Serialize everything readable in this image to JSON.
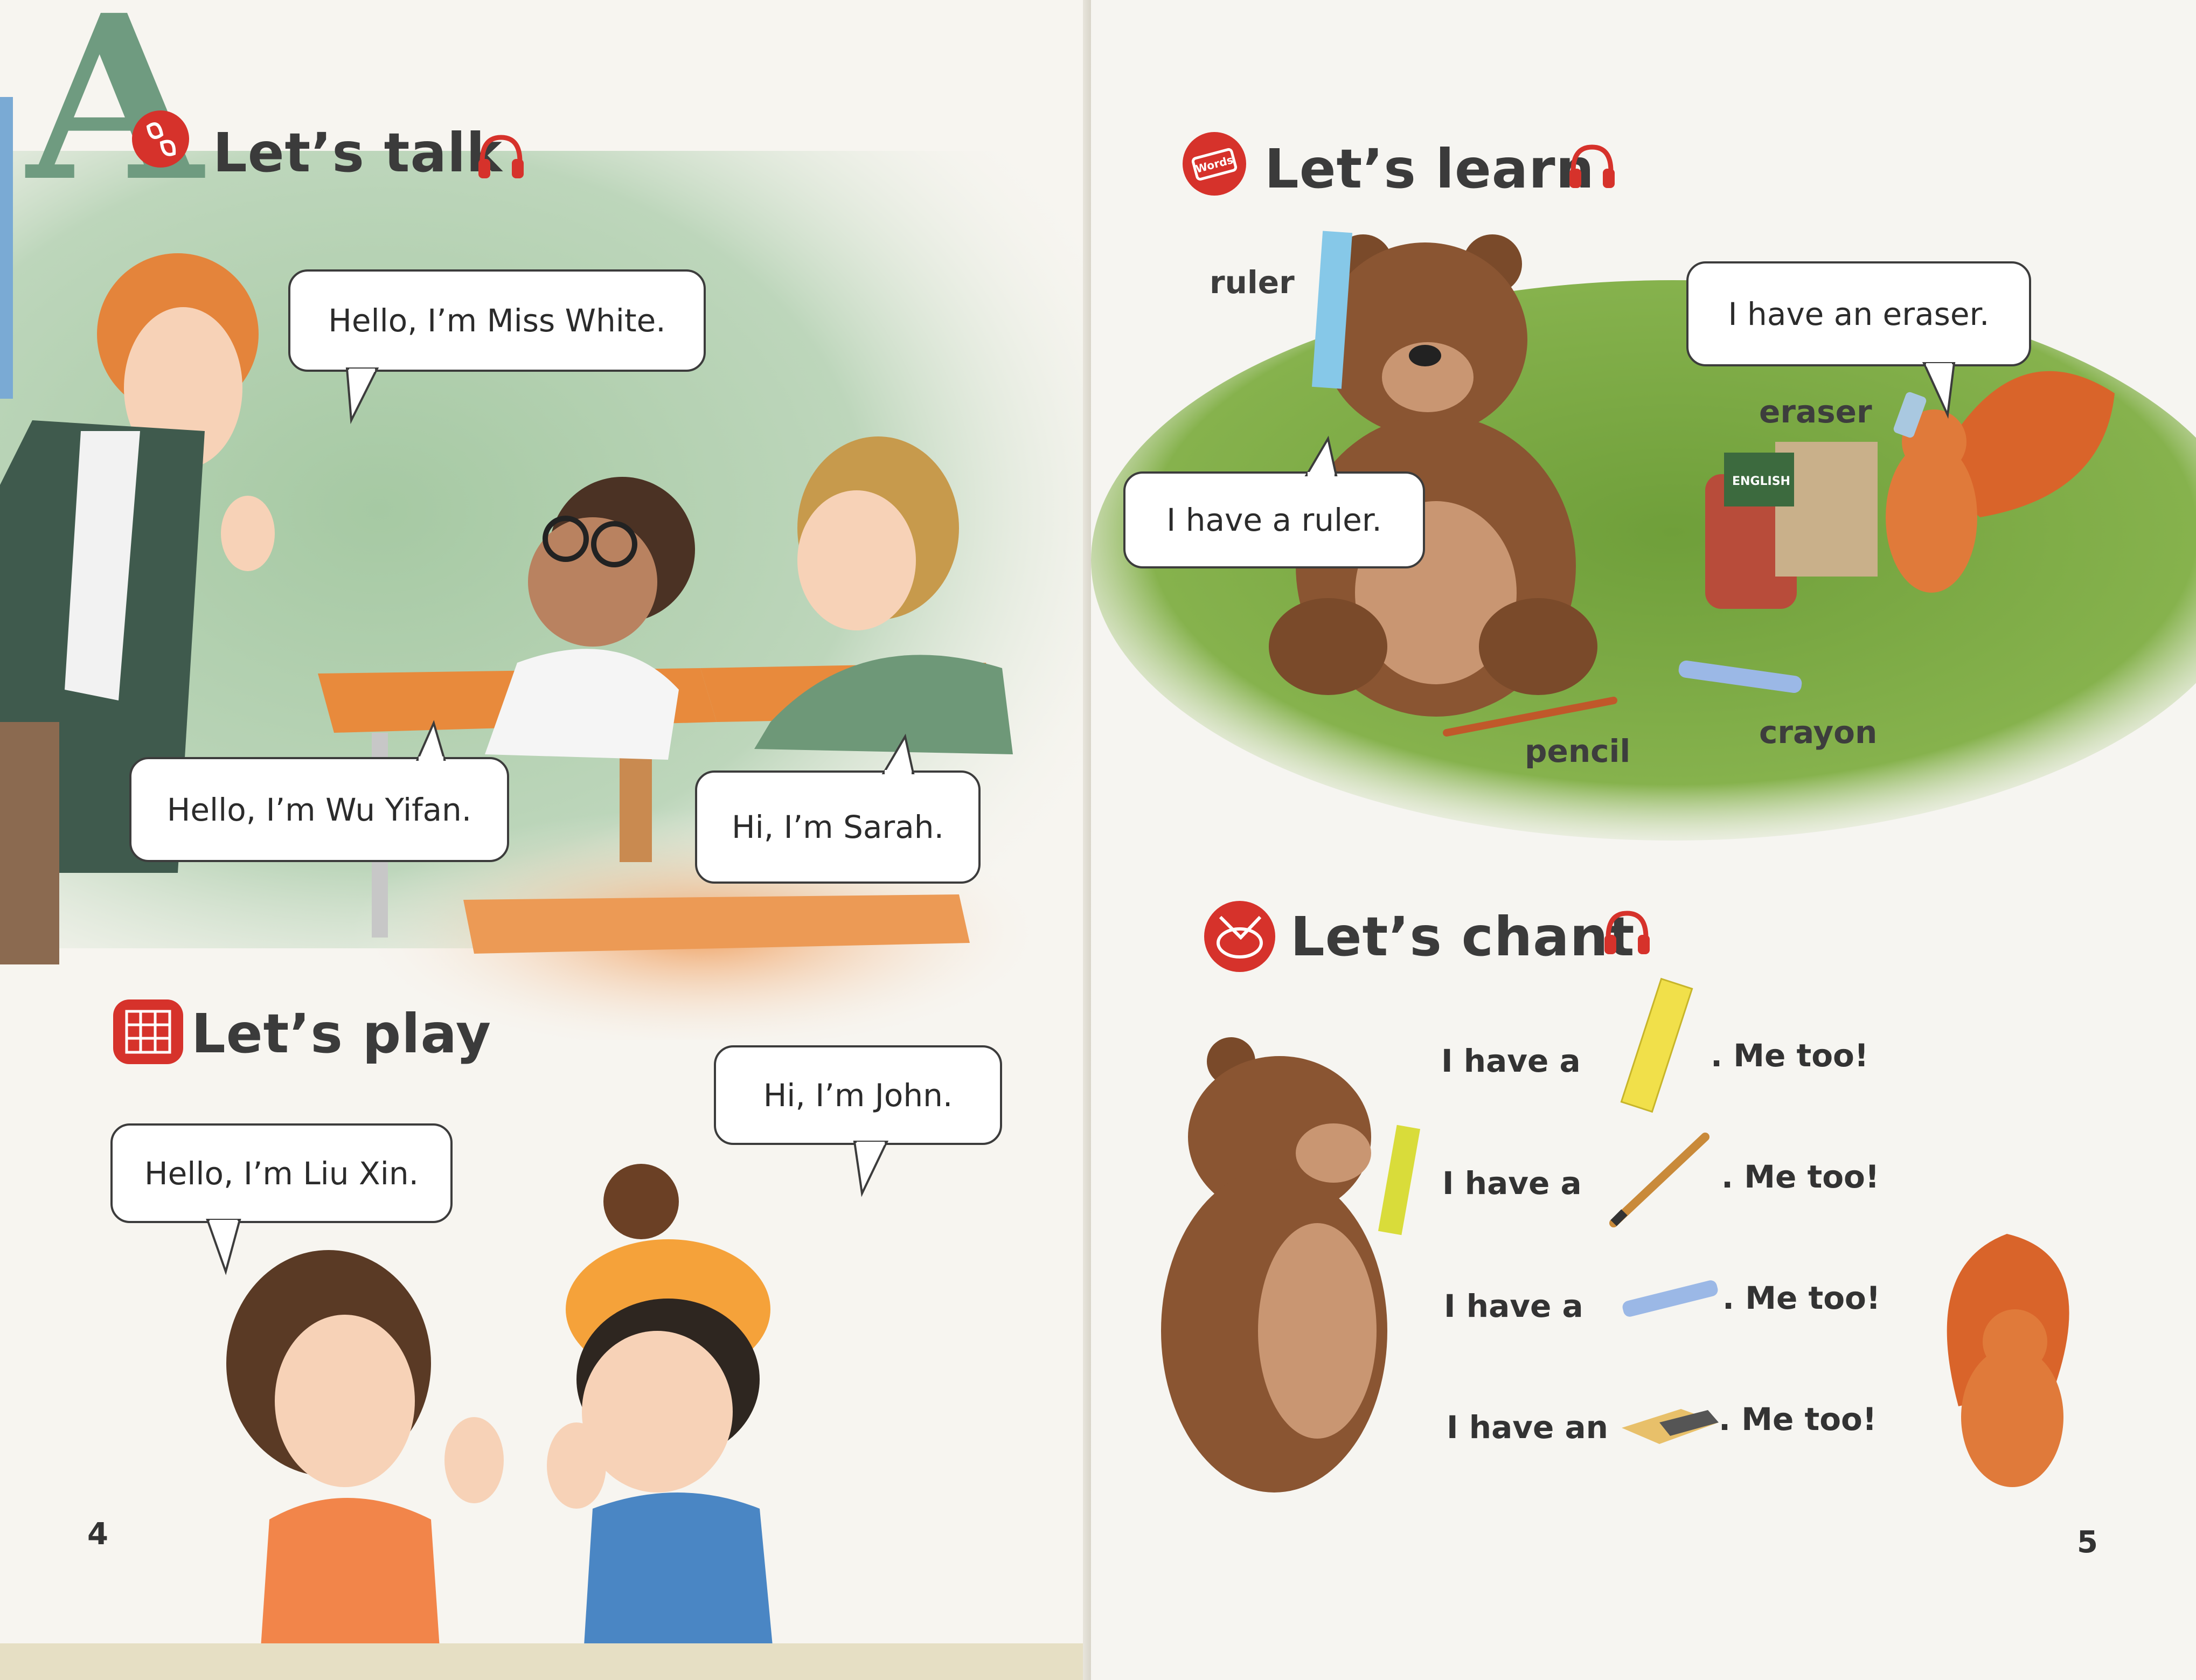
{
  "left_page": {
    "unit_letter": "A",
    "talk": {
      "title": "Let’s talk",
      "bubbles": {
        "teacher": "Hello, I’m Miss White.",
        "boy": "Hello, I’m Wu Yifan.",
        "girl": "Hi, I’m Sarah."
      }
    },
    "play": {
      "title": "Let’s play",
      "bubbles": {
        "girl": "Hello, I’m Liu Xin.",
        "boy": "Hi, I’m John."
      }
    },
    "page_number": "4"
  },
  "right_page": {
    "learn": {
      "title": "Let’s learn",
      "badge": "Words",
      "words": {
        "ruler": "ruler",
        "eraser": "eraser",
        "pencil": "pencil",
        "crayon": "crayon"
      },
      "book_label": "ENGLISH",
      "bubbles": {
        "bear": "I have a ruler.",
        "squirrel": "I have an eraser."
      }
    },
    "chant": {
      "title": "Let’s chant",
      "lines": [
        {
          "lead": "I have a",
          "reply": ". Me too!",
          "item_icon": "ruler-icon"
        },
        {
          "lead": "I have a",
          "reply": ". Me too!",
          "item_icon": "pencil-icon"
        },
        {
          "lead": "I have a",
          "reply": ". Me too!",
          "item_icon": "crayon-icon"
        },
        {
          "lead": "I have an",
          "reply": ". Me too!",
          "item_icon": "eraser-icon"
        }
      ]
    },
    "page_number": "5"
  },
  "colors": {
    "accent_red": "#d6322b",
    "grass_green": "#78a83e",
    "classroom_green": "#8fb58f",
    "desk_orange": "#e8873a"
  }
}
